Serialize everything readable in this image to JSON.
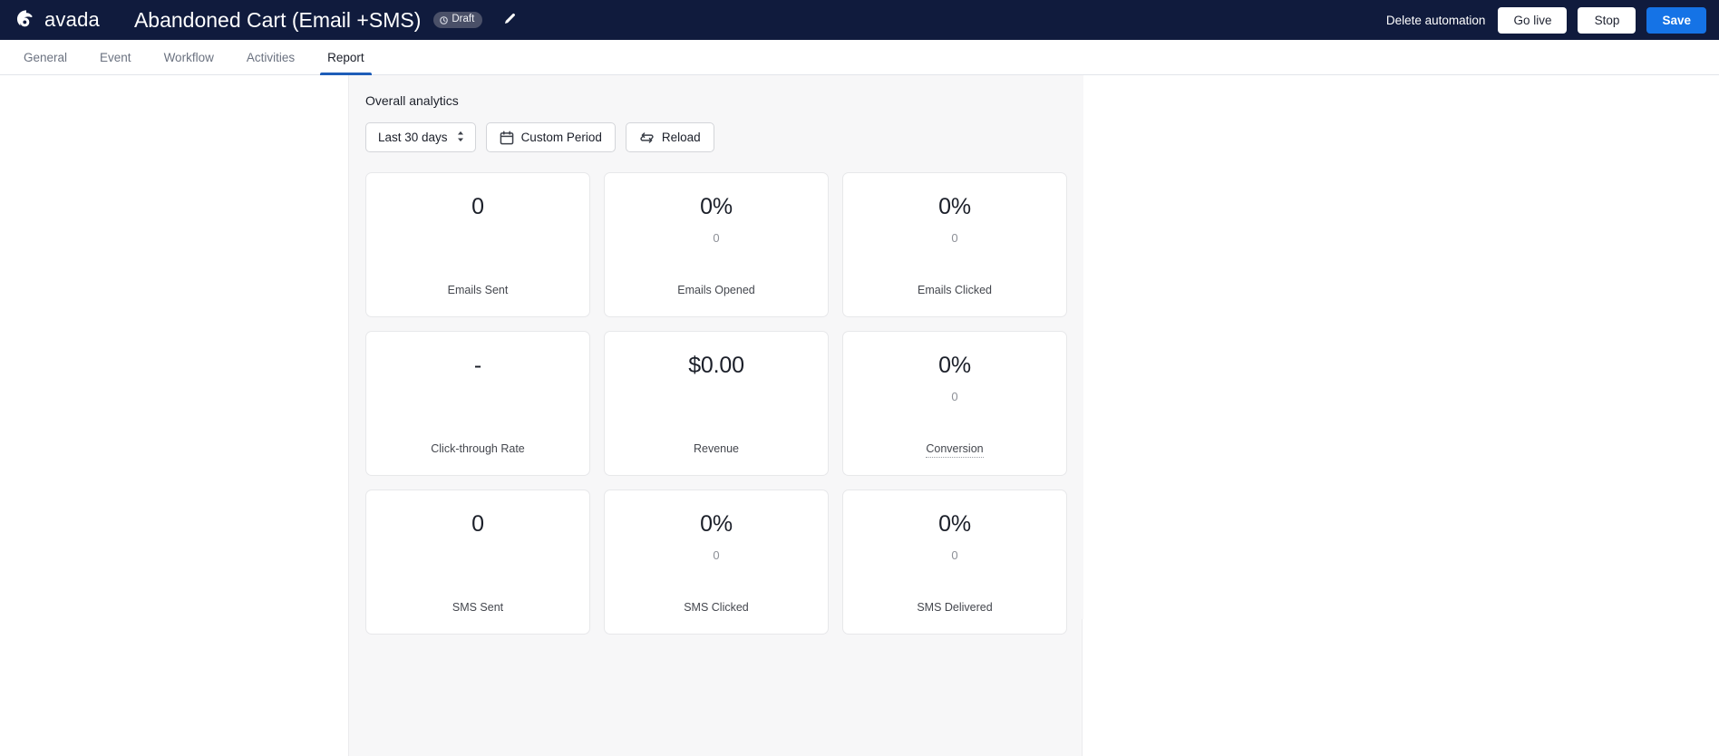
{
  "topbar": {
    "brand_name": "avada",
    "brand_icon": "avada-logo-icon",
    "doc_title": "Abandoned Cart (Email +SMS)",
    "status_badge": "Draft",
    "status_icon": "clock-icon",
    "edit_icon": "pencil-icon",
    "delete_label": "Delete automation",
    "golive_label": "Go live",
    "stop_label": "Stop",
    "save_label": "Save",
    "bg_color": "#101b3d",
    "save_color": "#1573e6"
  },
  "tabs": [
    {
      "label": "General",
      "active": false
    },
    {
      "label": "Event",
      "active": false
    },
    {
      "label": "Workflow",
      "active": false
    },
    {
      "label": "Activities",
      "active": false
    },
    {
      "label": "Report",
      "active": true
    }
  ],
  "panel": {
    "title": "Overall analytics",
    "toolbar": {
      "period_select": "Last 30 days",
      "period_options": [
        "Last 30 days"
      ],
      "select_icon": "chevron-updown-icon",
      "custom_period_label": "Custom Period",
      "custom_period_icon": "calendar-icon",
      "reload_label": "Reload",
      "reload_icon": "refresh-icon"
    },
    "stats": [
      {
        "value": "0",
        "sub": "",
        "label": "Emails Sent",
        "dotted": false
      },
      {
        "value": "0%",
        "sub": "0",
        "label": "Emails Opened",
        "dotted": false
      },
      {
        "value": "0%",
        "sub": "0",
        "label": "Emails Clicked",
        "dotted": false
      },
      {
        "value": "-",
        "sub": "",
        "label": "Click-through Rate",
        "dotted": false
      },
      {
        "value": "$0.00",
        "sub": "",
        "label": "Revenue",
        "dotted": false
      },
      {
        "value": "0%",
        "sub": "0",
        "label": "Conversion",
        "dotted": true
      },
      {
        "value": "0",
        "sub": "",
        "label": "SMS Sent",
        "dotted": false
      },
      {
        "value": "0%",
        "sub": "0",
        "label": "SMS Clicked",
        "dotted": false
      },
      {
        "value": "0%",
        "sub": "0",
        "label": "SMS Delivered",
        "dotted": false
      }
    ]
  }
}
